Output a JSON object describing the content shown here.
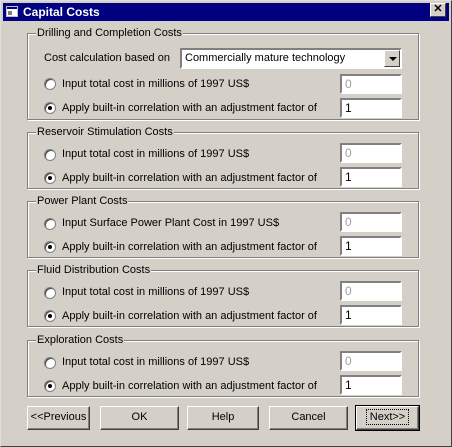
{
  "window": {
    "title": "Capital Costs",
    "close_glyph": "✕",
    "title_icon": "app-window-icon"
  },
  "drilling": {
    "legend": "Drilling and Completion Costs",
    "calc_label": "Cost calculation based on",
    "calc_selected": "Commercially mature technology",
    "opt_total_label": "Input total cost in millions of 1997 US$",
    "opt_total_value": "0",
    "opt_corr_label": "Apply built-in correlation with an adjustment factor of",
    "opt_corr_value": "1",
    "selected": "correlation"
  },
  "reservoir": {
    "legend": "Reservoir Stimulation Costs",
    "opt_total_label": "Input total cost in millions of 1997 US$",
    "opt_total_value": "0",
    "opt_corr_label": "Apply built-in correlation with an adjustment factor of",
    "opt_corr_value": "1",
    "selected": "correlation"
  },
  "power_plant": {
    "legend": "Power Plant Costs",
    "opt_total_label": "Input Surface Power Plant Cost in 1997 US$",
    "opt_total_value": "0",
    "opt_corr_label": "Apply built-in correlation with an adjustment factor of",
    "opt_corr_value": "1",
    "selected": "correlation"
  },
  "fluid": {
    "legend": "Fluid Distribution Costs",
    "opt_total_label": "Input total cost in millions of 1997 US$",
    "opt_total_value": "0",
    "opt_corr_label": "Apply built-in correlation with an adjustment factor of",
    "opt_corr_value": "1",
    "selected": "correlation"
  },
  "exploration": {
    "legend": "Exploration Costs",
    "opt_total_label": "Input total cost in millions of 1997 US$",
    "opt_total_value": "0",
    "opt_corr_label": "Apply built-in correlation with an adjustment factor of",
    "opt_corr_value": "1",
    "selected": "correlation"
  },
  "buttons": {
    "previous": "<<Previous",
    "ok": "OK",
    "help": "Help",
    "cancel": "Cancel",
    "next": "Next>>"
  }
}
